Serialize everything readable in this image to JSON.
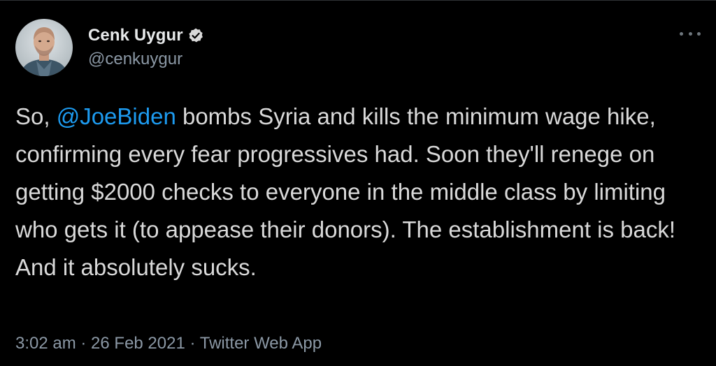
{
  "author": {
    "display_name": "Cenk Uygur",
    "handle": "@cenkuygur",
    "verified": true,
    "avatar_icon": "profile-photo"
  },
  "tweet": {
    "text_before": "So, ",
    "mention": "@JoeBiden",
    "text_after": " bombs Syria and kills the minimum wage hike, confirming every fear progressives had. Soon they'll renege on getting $2000 checks to everyone in the middle class by limiting who gets it (to appease their donors). The establishment is back! And it absolutely sucks."
  },
  "meta": {
    "time": "3:02 am",
    "separator": " · ",
    "date": "26 Feb 2021",
    "source": "Twitter Web App"
  },
  "colors": {
    "background": "#000000",
    "text": "#d9d9d9",
    "link": "#1d9bf0",
    "muted": "#8b98a5",
    "verified": "#d9d9d9"
  },
  "icons": {
    "more": "more-horizontal-icon",
    "verified": "verified-badge-icon"
  }
}
